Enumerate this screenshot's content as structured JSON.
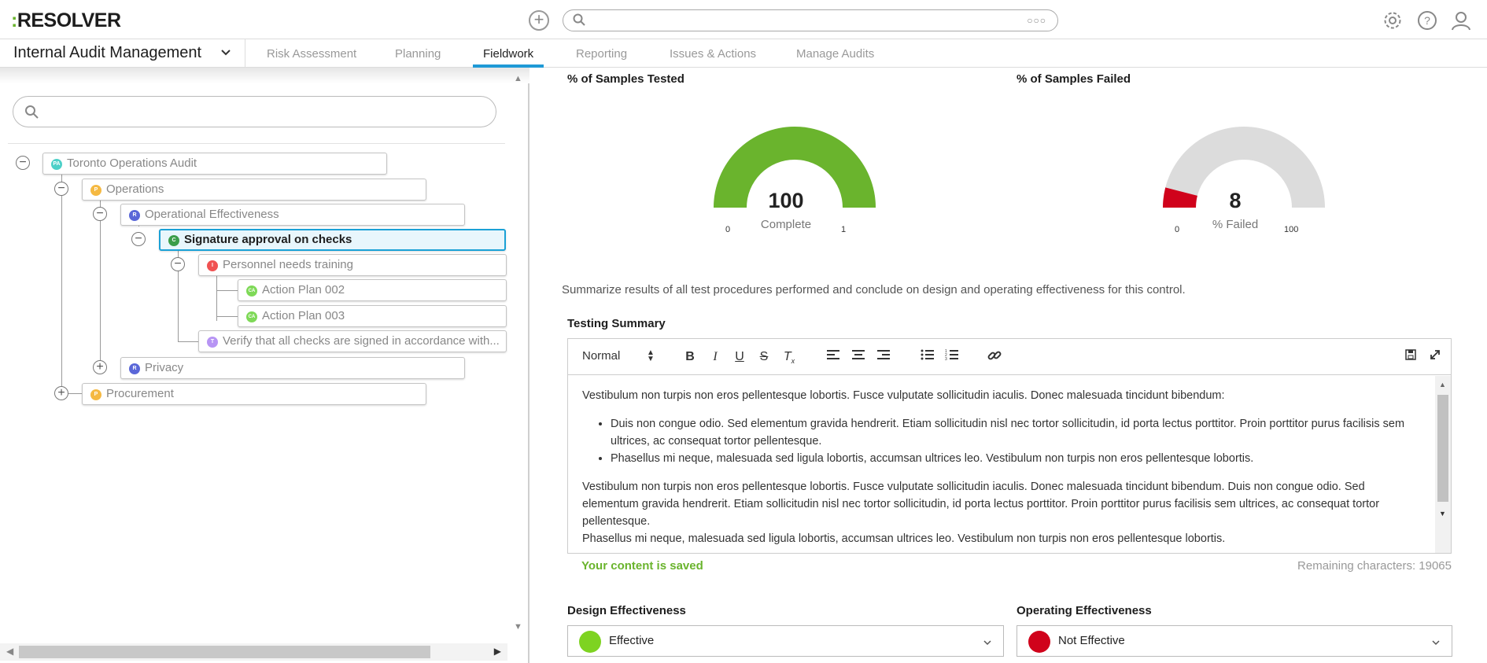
{
  "header": {
    "logo_text": "RESOLVER",
    "logo_colon": ":",
    "search_dots": "○○○"
  },
  "subnav": {
    "app_title": "Internal Audit Management",
    "tabs": [
      {
        "label": "Risk Assessment",
        "active": false
      },
      {
        "label": "Planning",
        "active": false
      },
      {
        "label": "Fieldwork",
        "active": true
      },
      {
        "label": "Reporting",
        "active": false
      },
      {
        "label": "Issues & Actions",
        "active": false
      },
      {
        "label": "Manage Audits",
        "active": false
      }
    ]
  },
  "tree": {
    "nodes": [
      {
        "badge": "PA",
        "badge_color": "#4dd0c8",
        "label": "Toronto Operations Audit",
        "toggle": "−"
      },
      {
        "badge": "P",
        "badge_color": "#f5b942",
        "label": "Operations",
        "toggle": "−"
      },
      {
        "badge": "R",
        "badge_color": "#5a67d8",
        "label": "Operational Effectiveness",
        "toggle": "−"
      },
      {
        "badge": "C",
        "badge_color": "#3a9d4a",
        "label": "Signature approval on checks",
        "toggle": "−"
      },
      {
        "badge": "I",
        "badge_color": "#f05252",
        "label": "Personnel needs training",
        "toggle": "−"
      },
      {
        "badge": "CA",
        "badge_color": "#7ed957",
        "label": "Action Plan 002"
      },
      {
        "badge": "CA",
        "badge_color": "#7ed957",
        "label": "Action Plan 003"
      },
      {
        "badge": "T",
        "badge_color": "#b794f4",
        "label": "Verify that all checks are signed in accordance with..."
      },
      {
        "badge": "R",
        "badge_color": "#5a67d8",
        "label": "Privacy",
        "toggle": "+"
      },
      {
        "badge": "P",
        "badge_color": "#f5b942",
        "label": "Procurement",
        "toggle": "+"
      }
    ]
  },
  "gauges": [
    {
      "title": "% of Samples Tested",
      "value": "100",
      "label": "Complete",
      "min": "0",
      "max": "1",
      "fill_fraction": 1.0,
      "color": "#6ab42d"
    },
    {
      "title": "% of Samples Failed",
      "value": "8",
      "label": "% Failed",
      "min": "0",
      "max": "100",
      "fill_fraction": 0.08,
      "color": "#d0021b"
    }
  ],
  "instruction": "Summarize results of all test procedures performed and conclude on design and operating effectiveness for this control.",
  "testing_summary": {
    "label": "Testing Summary",
    "format": "Normal",
    "para1": "Vestibulum non turpis non eros pellentesque lobortis. Fusce vulputate sollicitudin iaculis. Donec malesuada tincidunt bibendum:",
    "bullets": [
      "Duis non congue odio. Sed elementum gravida hendrerit. Etiam sollicitudin nisl nec tortor sollicitudin, id porta lectus porttitor. Proin porttitor purus facilisis sem ultrices, ac consequat tortor pellentesque.",
      "Phasellus mi neque, malesuada sed ligula lobortis, accumsan ultrices leo. Vestibulum non turpis non eros pellentesque lobortis."
    ],
    "para2": "Vestibulum non turpis non eros pellentesque lobortis. Fusce vulputate sollicitudin iaculis. Donec malesuada tincidunt bibendum. Duis non congue odio. Sed elementum gravida hendrerit. Etiam sollicitudin nisl nec tortor sollicitudin, id porta lectus porttitor. Proin porttitor purus facilisis sem ultrices, ac consequat tortor pellentesque.",
    "para3": "Phasellus mi neque, malesuada sed ligula lobortis, accumsan ultrices leo. Vestibulum non turpis non eros pellentesque lobortis.",
    "saved_msg": "Your content is saved",
    "remaining": "Remaining characters: 19065"
  },
  "design_effectiveness": {
    "label": "Design Effectiveness",
    "value": "Effective",
    "color": "#6ab42d"
  },
  "operating_effectiveness": {
    "label": "Operating Effectiveness",
    "value": "Not Effective",
    "color": "#d0021b"
  }
}
